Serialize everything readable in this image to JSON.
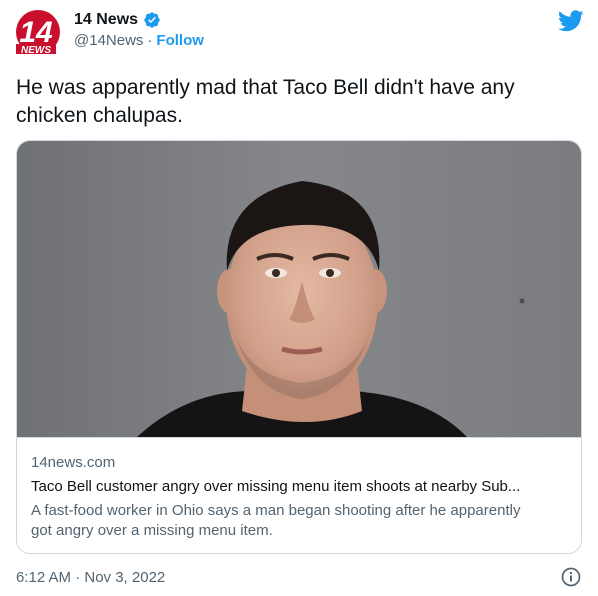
{
  "account": {
    "logo_text": "14",
    "logo_subtext": "NEWS",
    "name": "14 News",
    "handle": "@14News",
    "separator": "·",
    "follow_label": "Follow"
  },
  "icons": {
    "verified": "verified-badge-icon",
    "platform": "twitter-bird-icon",
    "info": "info-icon"
  },
  "colors": {
    "accent": "#1d9bf0",
    "logo_red": "#c8102e",
    "text_primary": "#0f1419",
    "text_secondary": "#536471",
    "border": "#cfd9de"
  },
  "tweet": {
    "text": "He was apparently mad that Taco Bell didn't have any chicken chalupas.",
    "timestamp": "6:12 AM · Nov 3, 2022"
  },
  "link_card": {
    "domain": "14news.com",
    "title": "Taco Bell customer angry over missing menu item shoots at nearby Sub...",
    "description": "A fast-food worker in Ohio says a man began shooting after he apparently got angry over a missing menu item."
  }
}
